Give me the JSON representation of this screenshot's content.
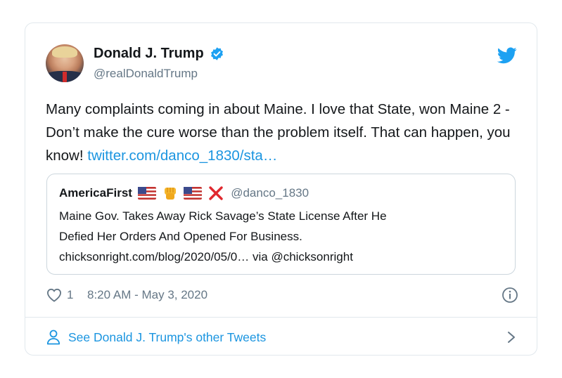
{
  "tweet": {
    "author_name": "Donald J. Trump",
    "author_handle": "@realDonaldTrump",
    "text": "Many complaints coming in about Maine. I love that State, won Maine 2 - Don’t make the cure worse than the problem itself. That can happen, you know! ",
    "link": "twitter.com/danco_1830/sta…",
    "likes": "1",
    "timestamp": "8:20 AM - May 3, 2020"
  },
  "quoted": {
    "author_name": "AmericaFirst",
    "author_handle": "@danco_1830",
    "line1": "Maine Gov. Takes Away Rick Savage’s State License After He",
    "line2": "Defied Her Orders And Opened For Business.",
    "line3": "chicksonright.com/blog/2020/05/0… via @chicksonright",
    "emoji": [
      "us-flag",
      "raised-fist",
      "us-flag",
      "cross-mark"
    ]
  },
  "footer": {
    "see_more": "See Donald J. Trump's other Tweets"
  },
  "colors": {
    "link": "#1b95e0",
    "verified": "#1da1f2",
    "muted": "#657786",
    "border": "#e1e8ed"
  },
  "icons": [
    "verified-badge-icon",
    "twitter-bird-icon",
    "heart-icon",
    "info-icon",
    "person-icon",
    "chevron-right-icon"
  ]
}
